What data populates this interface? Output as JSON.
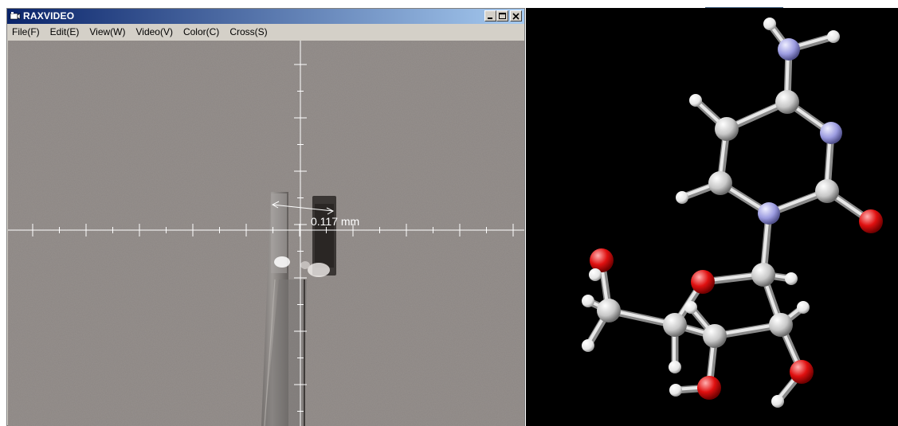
{
  "window": {
    "title": "RAXVIDEO",
    "buttons": {
      "minimize": "minimize",
      "maximize": "maximize",
      "close": "close"
    }
  },
  "menu": {
    "items": [
      {
        "label": "File(F)"
      },
      {
        "label": "Edit(E)"
      },
      {
        "label": "View(W)"
      },
      {
        "label": "Video(V)"
      },
      {
        "label": "Color(C)"
      },
      {
        "label": "Cross(S)"
      }
    ]
  },
  "video": {
    "measurement_label": "0.117 mm"
  },
  "molecule": {
    "atom_colors": {
      "carbon": "#d8d8d8",
      "nitrogen": "#9c9ce0",
      "oxygen": "#e01010",
      "hydrogen": "#f0f0f0"
    },
    "background": "#000000"
  },
  "colors": {
    "titlebar_start": "#0a246a",
    "titlebar_end": "#a6caf0",
    "crosshair": "#ffffff",
    "video_background": "#8c8683"
  }
}
